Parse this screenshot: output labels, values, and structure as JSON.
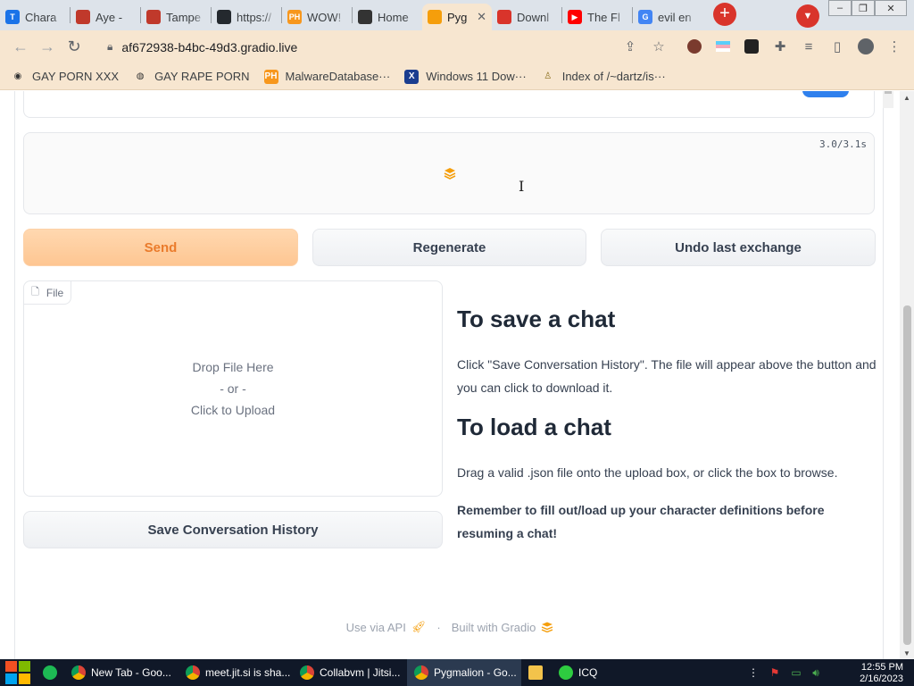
{
  "tabs": [
    {
      "title": "Chara",
      "icon": "character-ai-icon",
      "color": "#1a73e8",
      "glyph": "T"
    },
    {
      "title": "Aye -",
      "icon": "globe-icon",
      "color": "#c0392b",
      "glyph": ""
    },
    {
      "title": "Tampe",
      "icon": "tampermonkey-icon",
      "color": "#c0392b",
      "glyph": ""
    },
    {
      "title": "https://",
      "icon": "github-icon",
      "color": "#24292e",
      "glyph": ""
    },
    {
      "title": "WOW!",
      "icon": "pornhub-icon",
      "color": "#f7971d",
      "glyph": "PH"
    },
    {
      "title": "Home",
      "icon": "tumblr-like-icon",
      "color": "#333",
      "glyph": ""
    },
    {
      "title": "Pyg",
      "icon": "gradio-icon",
      "color": "#f59e0b",
      "glyph": "",
      "active": true
    },
    {
      "title": "Downl",
      "icon": "download-icon",
      "color": "#d9342b",
      "glyph": ""
    },
    {
      "title": "The Fl",
      "icon": "youtube-icon",
      "color": "#ff0000",
      "glyph": "▶"
    },
    {
      "title": "evil en",
      "icon": "google-icon",
      "color": "#4285f4",
      "glyph": "G"
    }
  ],
  "window_controls": [
    "–",
    "❐",
    "✕"
  ],
  "omnibox": {
    "url": "af672938-b4bc-49d3.gradio.live"
  },
  "bookmarks": [
    {
      "label": "GAY PORN XXX",
      "icon": "bookmark-site-icon",
      "glyph": "◉"
    },
    {
      "label": "GAY RAPE PORN",
      "icon": "globe-icon",
      "glyph": "◍"
    },
    {
      "label": "MalwareDatabase···",
      "icon": "pornhub-icon",
      "glyph": "PH"
    },
    {
      "label": "Windows 11 Dow···",
      "icon": "x-icon",
      "glyph": "X"
    },
    {
      "label": "Index of /~dartz/is···",
      "icon": "folder-icon",
      "glyph": "♙"
    }
  ],
  "output": {
    "timer": "3.0/3.1s"
  },
  "buttons": {
    "send": "Send",
    "regenerate": "Regenerate",
    "undo": "Undo last exchange",
    "save": "Save Conversation History"
  },
  "file_upload": {
    "label": "File",
    "drop_here": "Drop File Here",
    "or": "- or -",
    "click": "Click to Upload"
  },
  "instructions": {
    "save_title": "To save a chat",
    "save_text": "Click \"Save Conversation History\". The file will appear above the button and you can click to download it.",
    "load_title": "To load a chat",
    "load_text": "Drag a valid .json file onto the upload box, or click the box to browse.",
    "reminder": "Remember to fill out/load up your character definitions before resuming a chat!"
  },
  "footer": {
    "api": "Use via API",
    "separator": "·",
    "built": "Built with Gradio"
  },
  "taskbar": {
    "apps": [
      {
        "label": "New Tab - Goo...",
        "icon": "chrome-icon"
      },
      {
        "label": "meet.jit.si is sha...",
        "icon": "chrome-icon"
      },
      {
        "label": "Collabvm | Jitsi...",
        "icon": "chrome-icon"
      },
      {
        "label": "Pygmalion - Go...",
        "icon": "chrome-icon",
        "active": true
      },
      {
        "label": "",
        "icon": "file-explorer-icon"
      },
      {
        "label": "ICQ",
        "icon": "icq-icon"
      }
    ],
    "time": "12:55 PM",
    "date": "2/16/2023"
  }
}
